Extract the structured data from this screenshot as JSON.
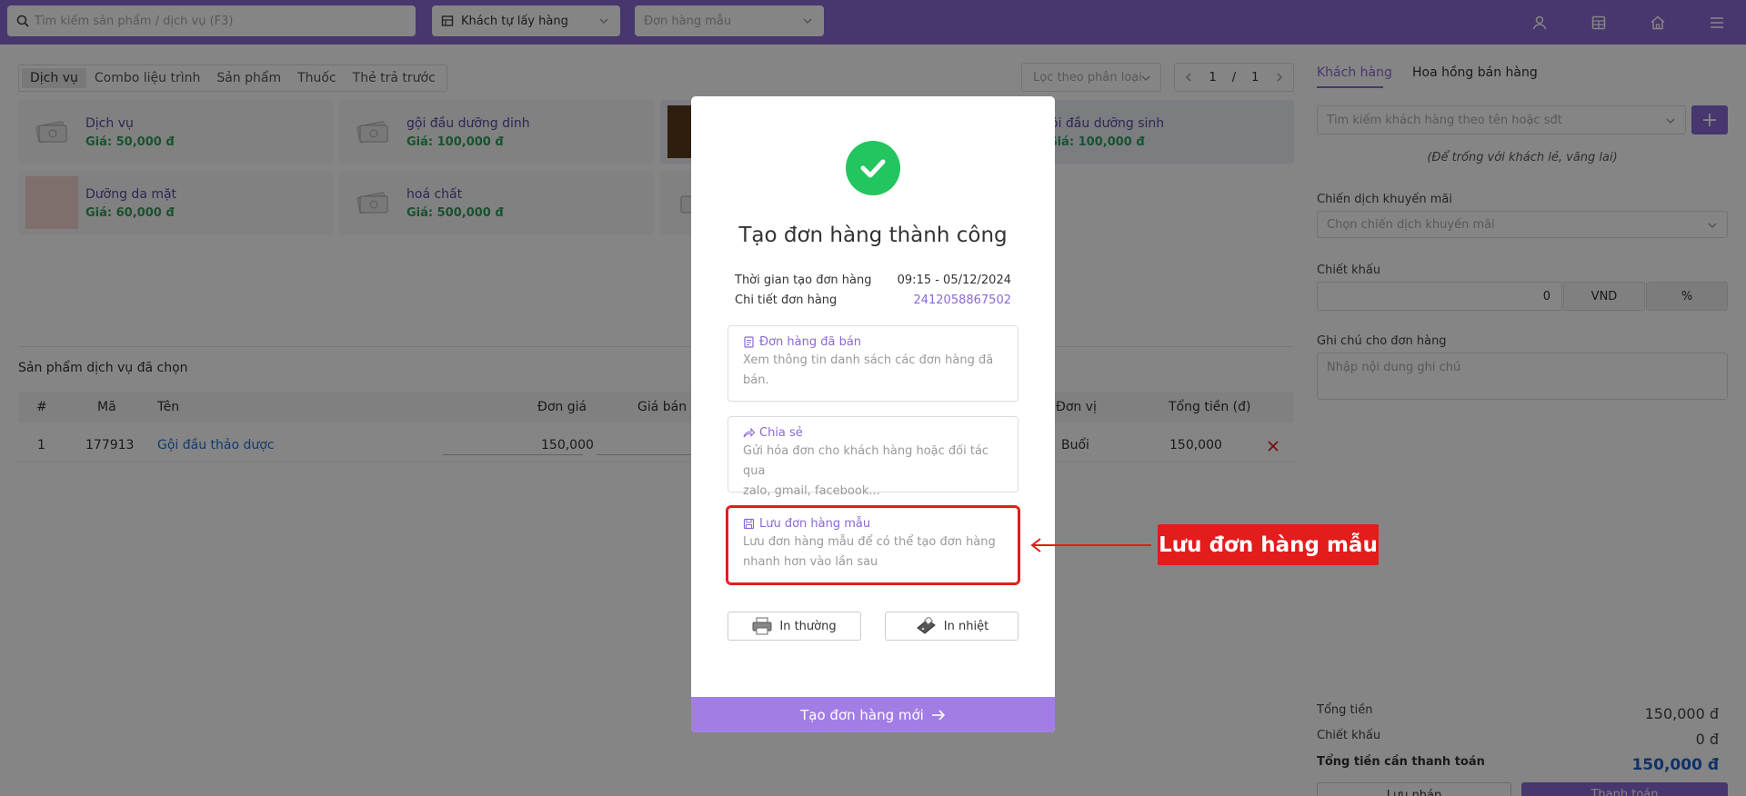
{
  "topbar": {
    "search_placeholder": "Tìm kiếm sản phẩm / dịch vụ (F3)",
    "delivery_select": "Khách tự lấy hàng",
    "template_select_placeholder": "Đơn hàng mẫu",
    "icons": [
      "user-icon",
      "calculator-icon",
      "home-icon",
      "menu-icon"
    ]
  },
  "tabs": [
    "Dịch vụ",
    "Combo liệu trình",
    "Sản phẩm",
    "Thuốc",
    "Thẻ trả trước"
  ],
  "filter_placeholder": "Lọc theo phân loại",
  "pager": {
    "current": "1",
    "sep": "/",
    "total": "1"
  },
  "cards": [
    {
      "name": "Dịch vụ",
      "price": "Giá: 50,000 đ"
    },
    {
      "name": "gội đầu dưỡng dinh",
      "price": "Giá: 100,000 đ"
    },
    {
      "name": "ội đầu dưỡng sinh",
      "price": "Giá: 100,000 đ"
    },
    {
      "name": "Dưỡng da mặt",
      "price": "Giá: 60,000 đ"
    },
    {
      "name": "hoá chất",
      "price": "Giá: 500,000 đ"
    }
  ],
  "selected_section_title": "Sản phẩm dịch vụ đã chọn",
  "table": {
    "headers": {
      "no": "#",
      "code": "Mã",
      "name": "Tên",
      "unit_price": "Đơn giá",
      "sale_price": "Giá bán s",
      "unit": "Đơn vị",
      "total": "Tổng tiền (đ)"
    },
    "rows": [
      {
        "no": "1",
        "code": "177913",
        "name": "Gội đầu thảo dược",
        "unit_price": "150,000",
        "unit": "Buổi",
        "total": "150,000"
      }
    ]
  },
  "right": {
    "tab_customer": "Khách hàng",
    "tab_commission": "Hoa hồng bán hàng",
    "customer_search_placeholder": "Tìm kiếm khách hàng theo tên hoặc sđt",
    "customer_hint": "(Để trống với khách lẻ, vãng lai)",
    "promo_label": "Chiến dịch khuyến mãi",
    "promo_placeholder": "Chọn chiến dịch khuyến mãi",
    "discount_label": "Chiết khấu",
    "discount_value": "0",
    "discount_vnd": "VND",
    "discount_pct": "%",
    "note_label": "Ghi chú cho đơn hàng",
    "note_placeholder": "Nhập nội dung ghi chú",
    "total_label": "Tổng tiền",
    "total_value": "150,000 đ",
    "discount_sum_label": "Chiết khấu",
    "discount_sum_value": "0 đ",
    "pay_label": "Tổng tiền cần thanh toán",
    "pay_value": "150,000 đ",
    "btn_draft": "Lưu nháp",
    "btn_pay": "Thanh toán"
  },
  "modal": {
    "title": "Tạo đơn hàng thành công",
    "time_label": "Thời gian tạo đơn hàng",
    "time_value": "09:15 - 05/12/2024",
    "detail_label": "Chi tiết đơn hàng",
    "detail_value": "2412058867502",
    "options": [
      {
        "title": "Đơn hàng đã bán",
        "desc1": "Xem thông tin danh sách các đơn hàng đã",
        "desc2": "bán."
      },
      {
        "title": "Chia sẻ",
        "desc1": "Gửi hóa đơn cho khách hàng hoặc đối tác qua",
        "desc2": "zalo, gmail, facebook..."
      },
      {
        "title": "Lưu đơn hàng mẫu",
        "desc1": "Lưu đơn hàng mẫu để có thể tạo đơn hàng",
        "desc2": "nhanh hơn vào lần sau"
      }
    ],
    "print_normal": "In thường",
    "print_thermal": "In nhiệt",
    "new_order": "Tạo đơn hàng mới"
  },
  "callout": "Lưu đơn hàng mẫu",
  "colors": {
    "accent": "#8a68d4",
    "success": "#23c55e",
    "highlight": "#e31c1c",
    "price": "#2e9d5a"
  }
}
